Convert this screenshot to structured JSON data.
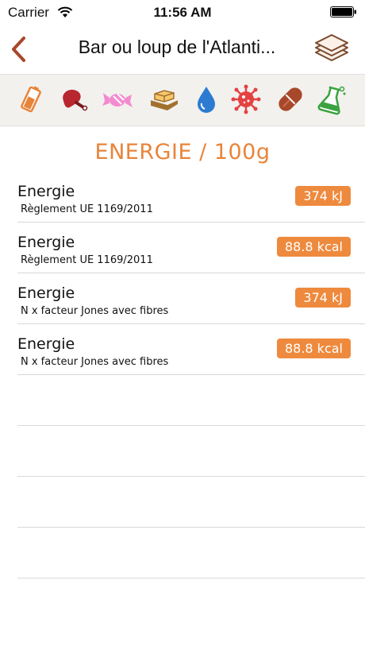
{
  "status_bar": {
    "carrier": "Carrier",
    "time": "11:56 AM"
  },
  "nav": {
    "title": "Bar ou loup de l'Atlanti..."
  },
  "categories": [
    "battery-energy",
    "meat",
    "candy-sugar",
    "butter-fat",
    "water",
    "virus-minerals",
    "capsule-vitamins",
    "flask-chemicals"
  ],
  "section": {
    "heading": "ENERGIE / 100g"
  },
  "rows": [
    {
      "title": "Energie",
      "subtitle": "Règlement UE 1169/2011",
      "value": "374 kJ"
    },
    {
      "title": "Energie",
      "subtitle": "Règlement UE 1169/2011",
      "value": "88.8 kcal"
    },
    {
      "title": "Energie",
      "subtitle": "N x facteur Jones avec fibres",
      "value": "374 kJ"
    },
    {
      "title": "Energie",
      "subtitle": "N x facteur Jones avec fibres",
      "value": "88.8 kcal"
    }
  ],
  "colors": {
    "accent": "#e8843a",
    "badge": "#ee8a3e",
    "back_arrow": "#a8482b",
    "category_bg": "#f2f1ee"
  }
}
